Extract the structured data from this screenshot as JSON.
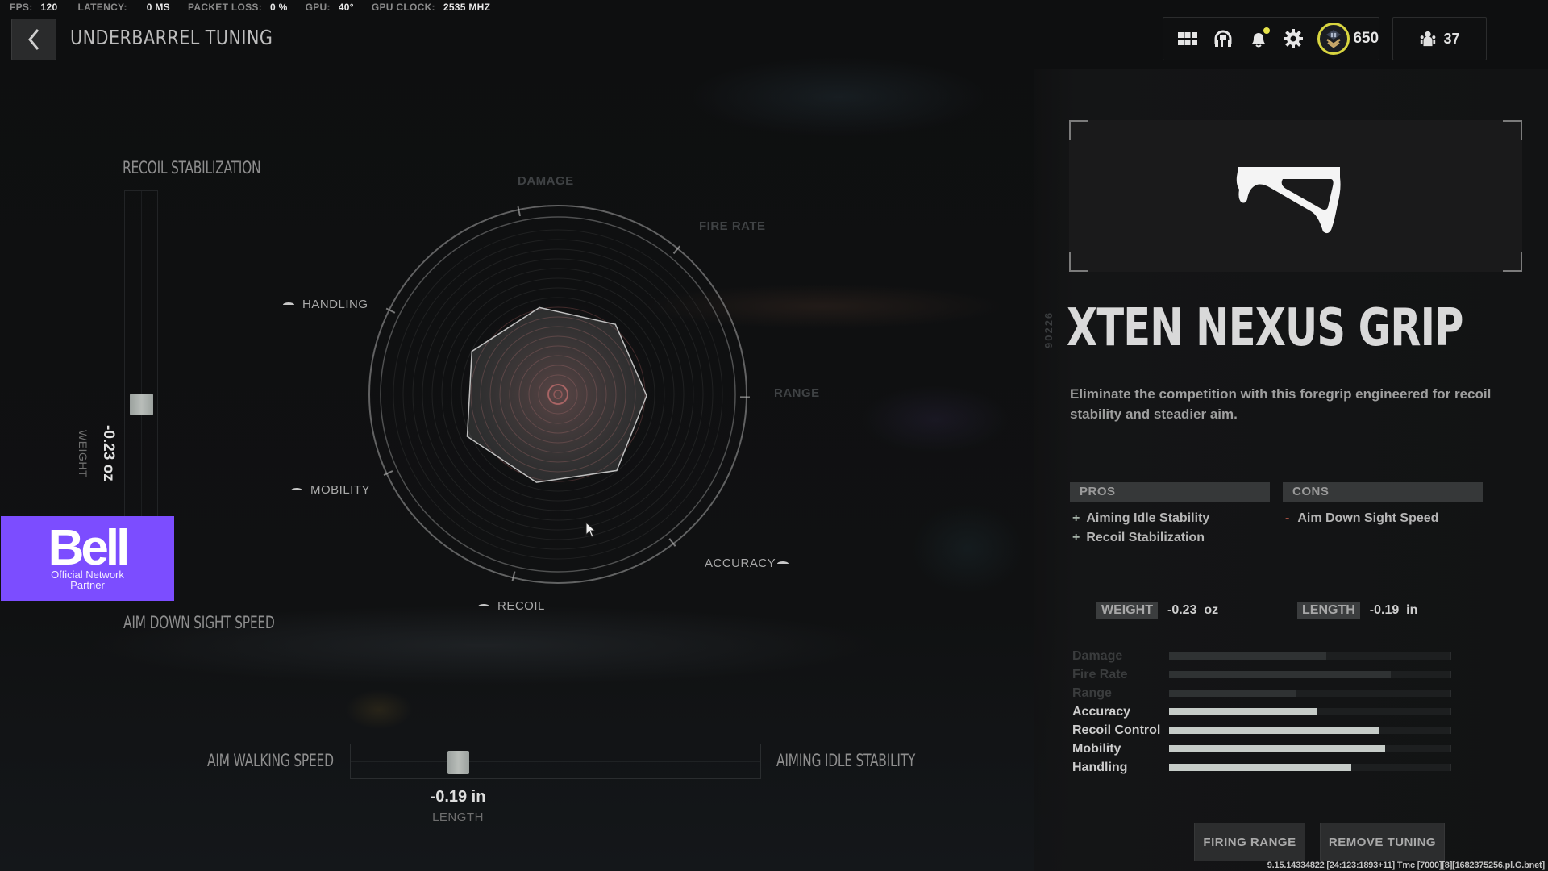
{
  "perf": [
    {
      "label": "FPS:",
      "value": "120"
    },
    {
      "label": "LATENCY:",
      "value": "0 MS"
    },
    {
      "label": "PACKET LOSS:",
      "value": "0 %"
    },
    {
      "label": "GPU:",
      "value": "40°"
    },
    {
      "label": "GPU CLOCK:",
      "value": "2535 MHZ"
    }
  ],
  "header": {
    "title": "UNDERBARREL TUNING",
    "back_icon": "chevron-left-icon"
  },
  "topbar": {
    "icons": [
      "grid-menu-icon",
      "headset-icon",
      "bell-notification-icon",
      "gear-icon"
    ],
    "notification_dot_color": "#e6e34a",
    "rank_value": "650",
    "rank_ring_color": "#d8d540",
    "party_icon": "players-icon",
    "player_count": "37"
  },
  "tuning": {
    "vertical": {
      "top_label": "RECOIL STABILIZATION",
      "bottom_label": "AIM DOWN SIGHT SPEED",
      "value": "-0.23 oz",
      "unit_label": "WEIGHT",
      "position_fraction_from_top": 0.8
    },
    "horizontal": {
      "left_label": "AIM WALKING SPEED",
      "right_label": "AIMING IDLE STABILITY",
      "value": "-0.19 in",
      "unit_label": "LENGTH",
      "position_fraction_from_left": 0.26
    }
  },
  "sponsor": {
    "logo": "Bell",
    "line1": "Official Network",
    "line2": "Partner",
    "color": "#7c4dff"
  },
  "chart_data": {
    "type": "radar",
    "axes": [
      "DAMAGE",
      "FIRE RATE",
      "RANGE",
      "ACCURACY",
      "RECOIL",
      "MOBILITY",
      "HANDLING"
    ],
    "values": [
      0.47,
      0.48,
      0.47,
      0.51,
      0.48,
      0.53,
      0.51
    ],
    "range": [
      0,
      1
    ],
    "modified_axes": [
      "HANDLING",
      "MOBILITY",
      "RECOIL",
      "ACCURACY"
    ],
    "dim_axes": [
      "DAMAGE",
      "FIRE RATE",
      "RANGE"
    ]
  },
  "item": {
    "code": "90226",
    "name": "XTEN NEXUS GRIP",
    "image_icon": "foregrip-icon",
    "description": "Eliminate the competition with this foregrip engineered for recoil stability and steadier aim.",
    "pros_header": "PROS",
    "cons_header": "CONS",
    "pros": [
      "Aiming Idle Stability",
      "Recoil Stabilization"
    ],
    "cons": [
      "Aim Down Sight Speed"
    ],
    "weight_label": "WEIGHT",
    "weight_value": "-0.23  oz",
    "length_label": "LENGTH",
    "length_value": "-0.19  in"
  },
  "stats": [
    {
      "name": "Damage",
      "value": 0.56,
      "active": false
    },
    {
      "name": "Fire Rate",
      "value": 0.79,
      "active": false
    },
    {
      "name": "Range",
      "value": 0.45,
      "active": false
    },
    {
      "name": "Accuracy",
      "value": 0.53,
      "active": true
    },
    {
      "name": "Recoil Control",
      "value": 0.75,
      "active": true
    },
    {
      "name": "Mobility",
      "value": 0.77,
      "active": true
    },
    {
      "name": "Handling",
      "value": 0.65,
      "active": true
    }
  ],
  "buttons": {
    "firing_range": "FIRING RANGE",
    "remove_tuning": "REMOVE TUNING"
  },
  "build_string": "9.15.14334822 [24:123:1893+11] Tmc [7000][8][1682375256.pl.G.bnet]"
}
